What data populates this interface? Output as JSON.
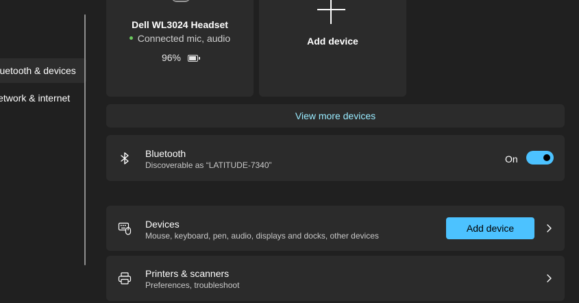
{
  "sidebar": {
    "items": [
      {
        "label": "Bluetooth & devices",
        "active": true
      },
      {
        "label": "Network & internet",
        "active": false
      }
    ]
  },
  "device_card": {
    "name": "Dell WL3024 Headset",
    "status": "Connected mic, audio",
    "battery": "96%",
    "status_color": "#6ccb5f"
  },
  "add_card": {
    "label": "Add device"
  },
  "view_more": {
    "label": "View more devices"
  },
  "bluetooth": {
    "title": "Bluetooth",
    "subtitle": "Discoverable as “LATITUDE-7340”",
    "toggle_label": "On",
    "toggle_on": true,
    "icon": "bluetooth-icon"
  },
  "devices": {
    "title": "Devices",
    "subtitle": "Mouse, keyboard, pen, audio, displays and docks, other devices",
    "button_label": "Add device",
    "icon": "keyboard-mouse-icon"
  },
  "printers": {
    "title": "Printers & scanners",
    "subtitle": "Preferences, troubleshoot",
    "icon": "printer-icon"
  },
  "colors": {
    "accent": "#4cc2ff",
    "link": "#99ebff",
    "background": "#202020",
    "card": "#2b2b2b"
  }
}
